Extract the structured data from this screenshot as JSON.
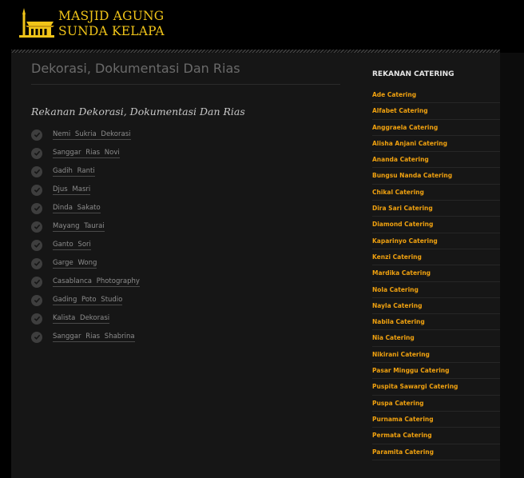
{
  "header": {
    "logo_line1": "MASJID AGUNG",
    "logo_line2": "SUNDA KELAPA",
    "logo_icon": "mosque-logo-icon",
    "accent_color": "#f0c419"
  },
  "main": {
    "page_title": "Dekorasi, Dokumentasi Dan Rias",
    "section_heading": "Rekanan Dekorasi, Dokumentasi Dan Rias",
    "list_icon": "check-circle-icon",
    "partners": [
      "Nemi Sukria Dekorasi",
      "Sanggar Rias Novi",
      "Gadih Ranti",
      "Djus Masri",
      "Dinda Sakato",
      "Mayang Taurai",
      "Ganto Sori",
      "Garge Wong",
      "Casablanca Photography",
      "Gading Poto Studio",
      "Kalista Dekorasi",
      "Sanggar Rias Shabrina"
    ]
  },
  "sidebar": {
    "title": "REKANAN CATERING",
    "link_color": "#f0a10f",
    "items": [
      "Ade Catering",
      "Alfabet Catering",
      "Anggraela Catering",
      "Alisha Anjani Catering",
      "Ananda Catering",
      "Bungsu Nanda Catering",
      "Chikal Catering",
      "Dira Sari Catering",
      "Diamond Catering",
      "Kaparinyo Catering",
      "Kenzi Catering",
      "Mardika Catering",
      "Nola Catering",
      "Nayla Catering",
      "Nabila Catering",
      "Nia Catering",
      "Nikirani Catering",
      "Pasar Minggu Catering",
      "Puspita Sawargi Catering",
      "Puspa Catering",
      "Purnama Catering",
      "Permata Catering",
      "Paramita Catering"
    ]
  }
}
